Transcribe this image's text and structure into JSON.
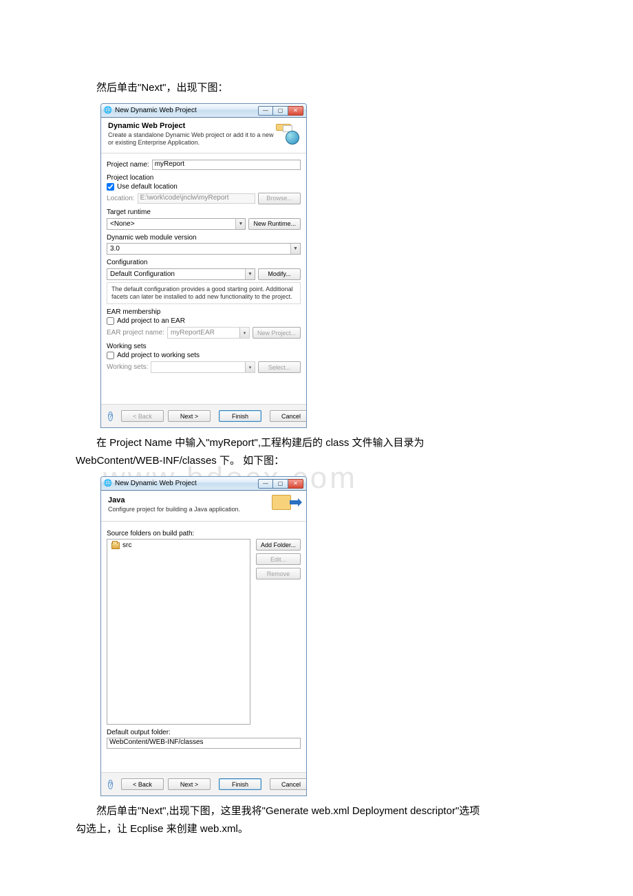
{
  "watermark": "www.bdocx.com",
  "para1": "然后单击\"Next\"，出现下图：",
  "para2a": "在 Project Name 中输入\"myReport\",工程构建后的 class 文件输入目录为",
  "para2b": "WebContent/WEB-INF/classes 下。 如下图：",
  "para3a": "然后单击\"Next\",出现下图，这里我将\"Generate web.xml Deployment descriptor\"选项",
  "para3b": "勾选上，让 Ecplise 来创建 web.xml。",
  "dlg1": {
    "title": "New Dynamic Web Project",
    "banner_title": "Dynamic Web Project",
    "banner_desc": "Create a standalone Dynamic Web project or add it to a new or existing Enterprise Application.",
    "project_name_label": "Project name:",
    "project_name_value": "myReport",
    "project_location": "Project location",
    "use_default_location": "Use default location",
    "use_default_checked": true,
    "location_label": "Location:",
    "location_value": "E:\\work\\code\\jnclw\\myReport",
    "browse": "Browse...",
    "target_runtime": "Target runtime",
    "runtime_value": "<None>",
    "new_runtime": "New Runtime...",
    "dyn_web_mod_ver": "Dynamic web module version",
    "dyn_web_value": "3.0",
    "configuration": "Configuration",
    "config_value": "Default Configuration",
    "modify": "Modify...",
    "config_desc": "The default configuration provides a good starting point. Additional facets can later be installed to add new functionality to the project.",
    "ear_membership": "EAR membership",
    "add_ear": "Add project to an EAR",
    "ear_name_label": "EAR project name:",
    "ear_name_value": "myReportEAR",
    "new_project": "New Project...",
    "working_sets": "Working sets",
    "add_ws": "Add project to working sets",
    "ws_label": "Working sets:",
    "select": "Select...",
    "back": "< Back",
    "next": "Next >",
    "finish": "Finish",
    "cancel": "Cancel"
  },
  "dlg2": {
    "title": "New Dynamic Web Project",
    "banner_title": "Java",
    "banner_desc": "Configure project for building a Java application.",
    "src_folders_label": "Source folders on build path:",
    "src_item": "src",
    "add_folder": "Add Folder...",
    "edit": "Edit...",
    "remove": "Remove",
    "def_output_label": "Default output folder:",
    "def_output_value": "WebContent/WEB-INF/classes",
    "back": "< Back",
    "next": "Next >",
    "finish": "Finish",
    "cancel": "Cancel"
  }
}
